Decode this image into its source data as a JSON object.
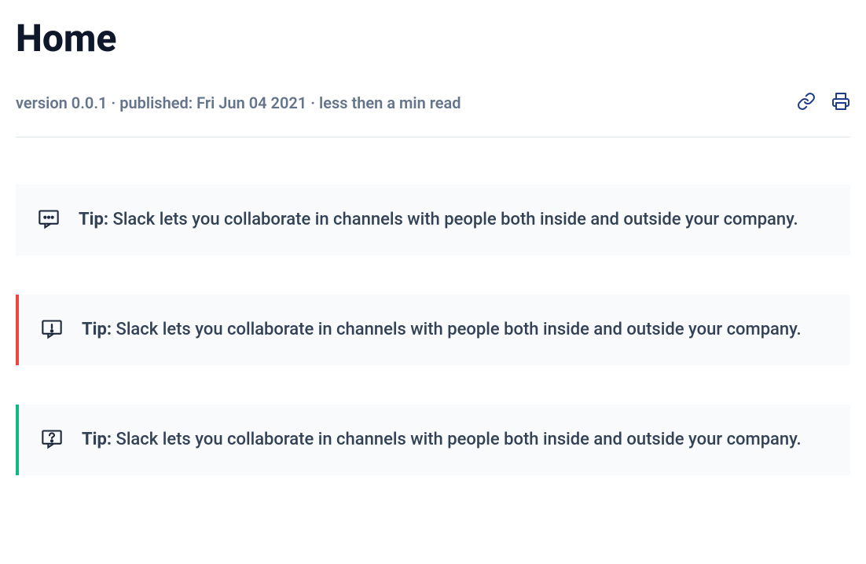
{
  "page": {
    "title": "Home"
  },
  "meta": {
    "text": "version 0.0.1 · published: Fri Jun 04 2021 · less then a min read"
  },
  "callouts": [
    {
      "label": "Tip:",
      "text": " Slack lets you collaborate in channels with people both inside and outside your company.",
      "variant": "info"
    },
    {
      "label": "Tip:",
      "text": " Slack lets you collaborate in channels with people both inside and outside your company.",
      "variant": "warning"
    },
    {
      "label": "Tip:",
      "text": " Slack lets you collaborate in channels with people both inside and outside your company.",
      "variant": "help"
    }
  ]
}
